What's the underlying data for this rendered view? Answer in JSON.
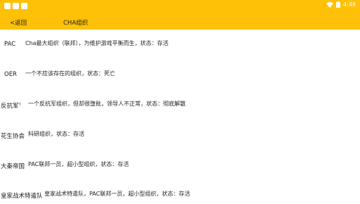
{
  "status_bar": {
    "time": "4:49",
    "wifi_icon": "wifi-icon",
    "battery_icon": "battery-icon"
  },
  "header": {
    "back_label": "<返回",
    "title": "CHA组织"
  },
  "rows": [
    {
      "name": "PAC",
      "desc": "Cha最大组织（联邦），为维护游戏平衡而生，状态：存活"
    },
    {
      "name": "OER",
      "desc": "一个不应该存在的组织，状态：死亡"
    },
    {
      "name": "反抗军ᵀ",
      "desc": "一个反抗军组织，但却很堕批，领导人不正常，状态：彻底解散"
    },
    {
      "name": "花生协会",
      "desc": "科研组织，状态：存活"
    },
    {
      "name": "大秦帝国",
      "desc": "PAC联邦一员，超小型组织，状态：存活"
    },
    {
      "name": "皇家战术特遣队",
      "desc": "皇家战术特遣队，PAC联邦一员，超小型组织，状态：存活"
    }
  ]
}
